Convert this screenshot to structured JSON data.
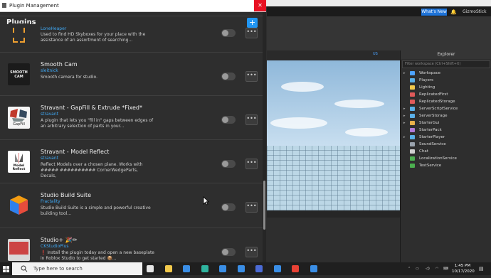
{
  "window": {
    "title": "Plugin Management",
    "close_glyph": "✕",
    "heading": "Plugins",
    "add_glyph": "+"
  },
  "plugins": [
    {
      "name": "",
      "author": "LoneHeaper",
      "description": "Used to find HD Skyboxes for your place with the assistance of an assortment of searching...",
      "enabled": false,
      "thumb_text": "",
      "icon": "skybox-bracket-icon",
      "thumb_color": "#2e2e2e"
    },
    {
      "name": "Smooth Cam",
      "author": "sleitnick",
      "description": "Smooth camera for studio.",
      "enabled": false,
      "thumb_text": "SMOOTH CAM",
      "icon": "smooth-cam-icon",
      "thumb_color": "#1b1b1b"
    },
    {
      "name": "Stravant - GapFill & Extrude *Fixed*",
      "author": "stravant",
      "description": "A plugin that lets you \"fill in\" gaps between edges of an arbitrary selection of parts in your...",
      "enabled": false,
      "thumb_text": "GapFill",
      "icon": "gapfill-icon",
      "thumb_color": "#f4f4f4"
    },
    {
      "name": "Stravant - Model Reflect",
      "author": "stravant",
      "description": "Reflect Models over a chosen plane. Works with ##### ########## CornerWedgeParts, Decals,",
      "enabled": false,
      "thumb_text": "Model Reflect",
      "icon": "model-reflect-icon",
      "thumb_color": "#ffffff"
    },
    {
      "name": "Studio Build Suite",
      "author": "Fractality",
      "description": "Studio Build Suite is a simple and powerful creative building tool...",
      "enabled": false,
      "thumb_text": "",
      "icon": "build-suite-cube-icon",
      "thumb_color": "#2e2e2e"
    },
    {
      "name": "Studio+ 🎉✏",
      "author": "CKStudioPlus",
      "description": "❗ Install the plugin today and open a new baseplate in Roblox Studio to get started 📦...",
      "enabled": false,
      "thumb_text": "",
      "icon": "studio-plus-icon",
      "thumb_color": "#d9d9d9"
    }
  ],
  "more_glyph": "•••",
  "studio": {
    "whats_new": "What's New",
    "username": "GizmoStick",
    "us_badge": "US"
  },
  "explorer": {
    "title": "Explorer",
    "filter_placeholder": "Filter workspace (Ctrl+Shift+X)",
    "items": [
      {
        "label": "Workspace",
        "arrow": "▸",
        "color": "#4da3ff"
      },
      {
        "label": "Players",
        "arrow": "",
        "color": "#5ab0e8"
      },
      {
        "label": "Lighting",
        "arrow": "",
        "color": "#f2c94c"
      },
      {
        "label": "ReplicatedFirst",
        "arrow": "",
        "color": "#e05a5a"
      },
      {
        "label": "ReplicatedStorage",
        "arrow": "",
        "color": "#e05a5a"
      },
      {
        "label": "ServerScriptService",
        "arrow": "▸",
        "color": "#5ab0e8"
      },
      {
        "label": "ServerStorage",
        "arrow": "▸",
        "color": "#5ab0e8"
      },
      {
        "label": "StarterGui",
        "arrow": "▸",
        "color": "#e8b04a"
      },
      {
        "label": "StarterPack",
        "arrow": "",
        "color": "#b07ad9"
      },
      {
        "label": "StarterPlayer",
        "arrow": "▸",
        "color": "#5ab0e8"
      },
      {
        "label": "SoundService",
        "arrow": "",
        "color": "#9aa3ad"
      },
      {
        "label": "Chat",
        "arrow": "",
        "color": "#d0d0d0"
      },
      {
        "label": "LocalizationService",
        "arrow": "",
        "color": "#4caf50"
      },
      {
        "label": "TestService",
        "arrow": "",
        "color": "#4caf50"
      }
    ]
  },
  "taskbar": {
    "search_placeholder": "Type here to search",
    "time": "1:45 PM",
    "date": "10/17/2020",
    "apps": [
      {
        "name": "task-view-icon",
        "color": "#e6e6e6"
      },
      {
        "name": "file-explorer-icon",
        "color": "#f2c94c"
      },
      {
        "name": "mail-icon",
        "color": "#3a8ee6"
      },
      {
        "name": "edge-icon",
        "color": "#2fb5a0"
      },
      {
        "name": "onedrive-icon",
        "color": "#3a8ee6"
      },
      {
        "name": "cloud-icon",
        "color": "#3a8ee6"
      },
      {
        "name": "store-icon",
        "color": "#4b6bd6"
      },
      {
        "name": "xbox-icon",
        "color": "#3a8ee6"
      },
      {
        "name": "chrome-icon",
        "color": "#e94235"
      },
      {
        "name": "roblox-studio-icon",
        "color": "#3a8ee6"
      }
    ]
  }
}
